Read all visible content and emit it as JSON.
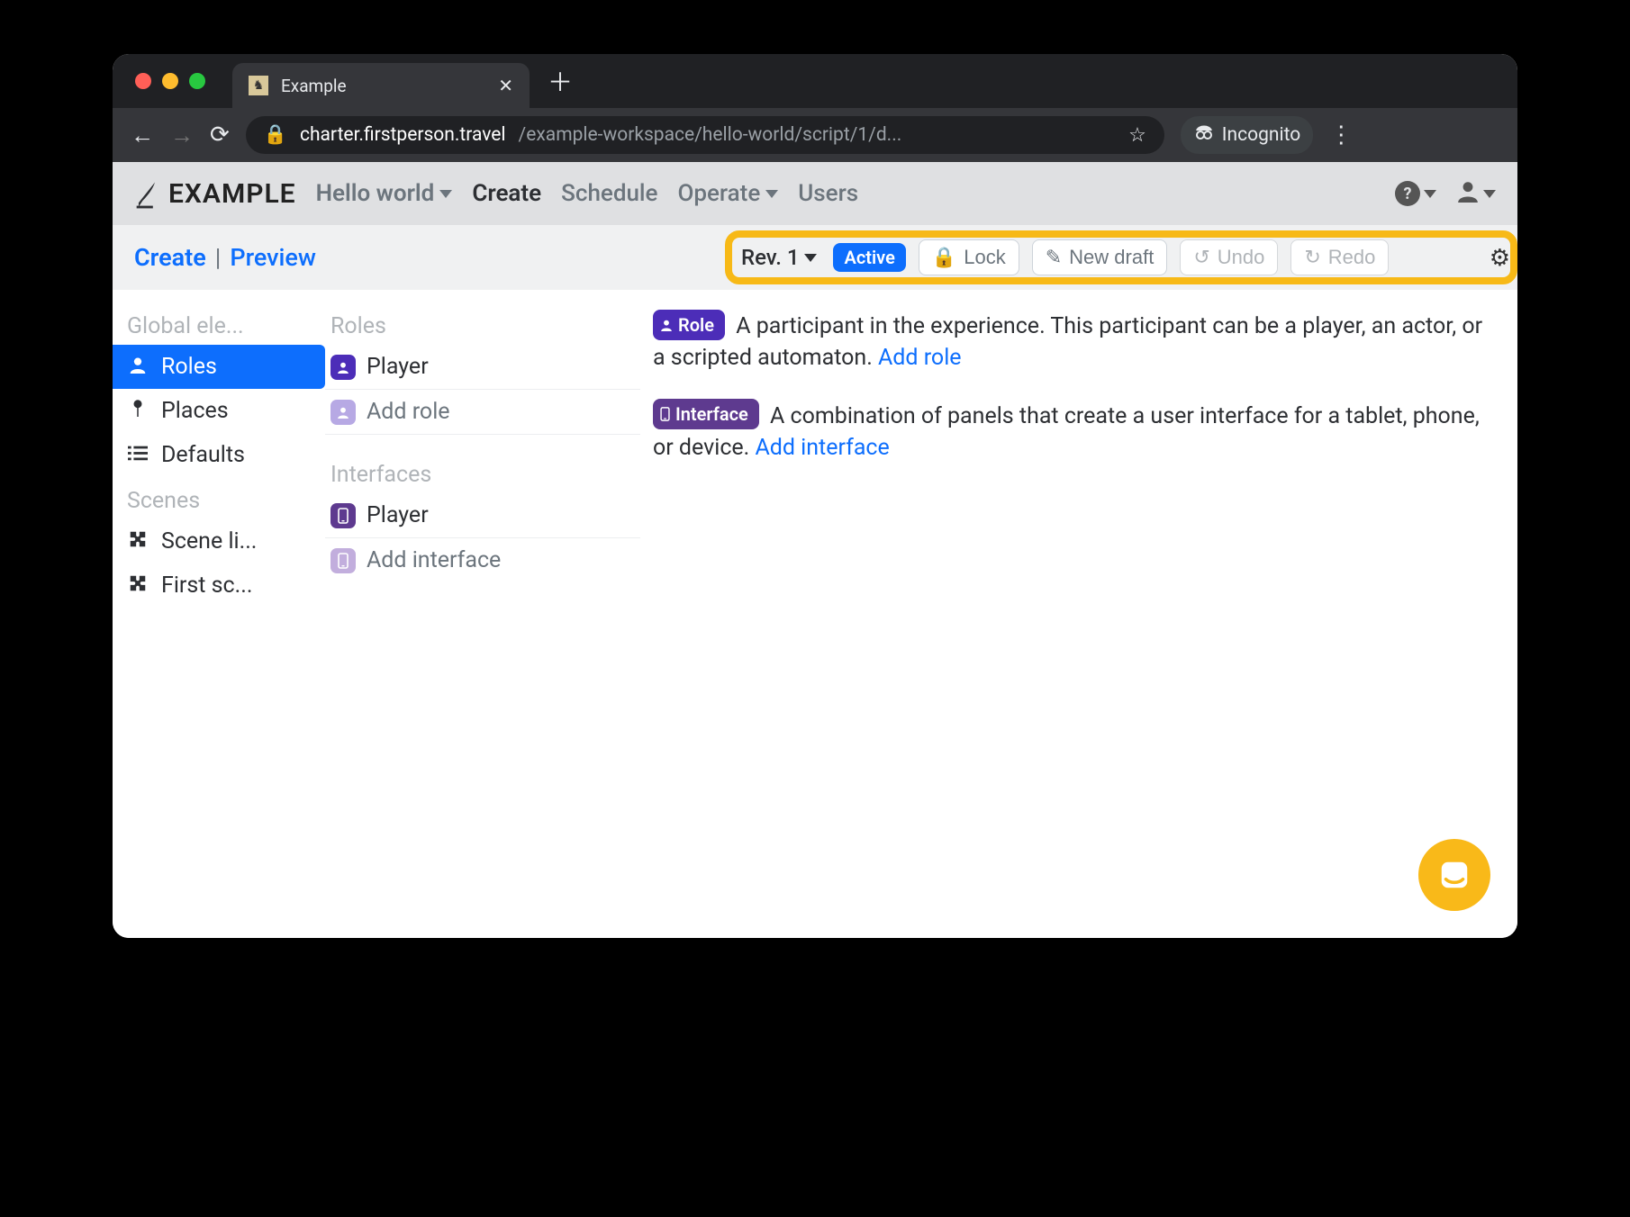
{
  "browser": {
    "tab_title": "Example",
    "url_host": "charter.firstperson.travel",
    "url_path": "/example-workspace/hello-world/script/1/d...",
    "incognito_label": "Incognito"
  },
  "header": {
    "brand": "EXAMPLE",
    "project": "Hello world",
    "nav": {
      "create": "Create",
      "schedule": "Schedule",
      "operate": "Operate",
      "users": "Users"
    }
  },
  "subheader": {
    "create": "Create",
    "separator": "|",
    "preview": "Preview",
    "revision": "Rev. 1",
    "status": "Active",
    "buttons": {
      "lock": "Lock",
      "new_draft": "New draft",
      "undo": "Undo",
      "redo": "Redo"
    }
  },
  "sidebar1": {
    "section_global": "Global ele...",
    "roles": "Roles",
    "places": "Places",
    "defaults": "Defaults",
    "section_scenes": "Scenes",
    "scene_list": "Scene li...",
    "first_scene": "First sc..."
  },
  "sidebar2": {
    "section_roles": "Roles",
    "player_role": "Player",
    "add_role": "Add role",
    "section_interfaces": "Interfaces",
    "player_iface": "Player",
    "add_interface": "Add interface"
  },
  "content": {
    "role_chip": "Role",
    "role_desc": "A participant in the experience. This participant can be a player, an actor, or a scripted automaton. ",
    "role_link": "Add role",
    "iface_chip": "Interface",
    "iface_desc": "A combination of panels that create a user interface for a tablet, phone, or device. ",
    "iface_link": "Add interface"
  }
}
